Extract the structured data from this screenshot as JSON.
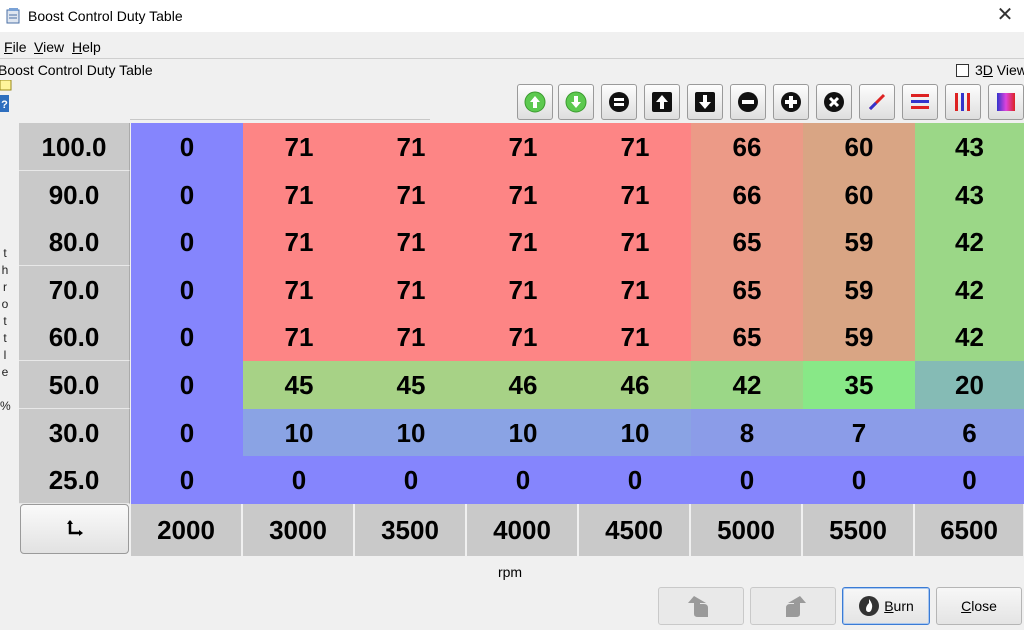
{
  "window": {
    "title": "Boost Control Duty Table"
  },
  "menu": [
    {
      "underline": "F",
      "rest": "ile"
    },
    {
      "underline": "V",
      "rest": "iew"
    },
    {
      "underline": "H",
      "rest": "elp"
    }
  ],
  "panel": {
    "title": "Boost Control Duty Table",
    "view3d_prefix": "3",
    "view3d_underline": "D",
    "view3d_suffix": " View"
  },
  "y_axis_label_chars": [
    "t",
    "h",
    "r",
    "o",
    "t",
    "t",
    "l",
    "e",
    "",
    "%"
  ],
  "x_axis_label": "rpm",
  "row_headers": [
    "100.0",
    "90.0",
    "80.0",
    "70.0",
    "60.0",
    "50.0",
    "30.0",
    "25.0"
  ],
  "col_headers": [
    "2000",
    "3000",
    "3500",
    "4000",
    "4500",
    "5000",
    "5500",
    "6500"
  ],
  "table": [
    [
      "0",
      "71",
      "71",
      "71",
      "71",
      "66",
      "60",
      "43"
    ],
    [
      "0",
      "71",
      "71",
      "71",
      "71",
      "66",
      "60",
      "43"
    ],
    [
      "0",
      "71",
      "71",
      "71",
      "71",
      "65",
      "59",
      "42"
    ],
    [
      "0",
      "71",
      "71",
      "71",
      "71",
      "65",
      "59",
      "42"
    ],
    [
      "0",
      "71",
      "71",
      "71",
      "71",
      "65",
      "59",
      "42"
    ],
    [
      "0",
      "45",
      "45",
      "46",
      "46",
      "42",
      "35",
      "20"
    ],
    [
      "0",
      "10",
      "10",
      "10",
      "10",
      "8",
      "7",
      "6"
    ],
    [
      "0",
      "0",
      "0",
      "0",
      "0",
      "0",
      "0",
      "0"
    ]
  ],
  "colors": {
    "blue": "#8585fd",
    "red": "#fd8585",
    "salmon": "#ec9a87",
    "tan": "#d9a584",
    "green": "#9bd787",
    "olive_green": "#a7d286",
    "light_green": "#88e887",
    "teal": "#85bbb5",
    "light_blue": "#8aa3e4",
    "mid_blue": "#8b9ce8",
    "blue2": "#8894ef"
  },
  "toolbar_icons": [
    "increment-green-icon",
    "decrement-green-icon",
    "equal-icon",
    "shift-up-icon",
    "shift-down-icon",
    "minus-icon",
    "plus-icon",
    "multiply-icon",
    "interpolate-icon",
    "horizontal-interpolate-icon",
    "vertical-interpolate-icon",
    "smooth-gradient-icon"
  ],
  "buttons": {
    "burn": {
      "underline": "B",
      "rest": "urn"
    },
    "close": {
      "underline": "C",
      "rest": "lose"
    }
  }
}
